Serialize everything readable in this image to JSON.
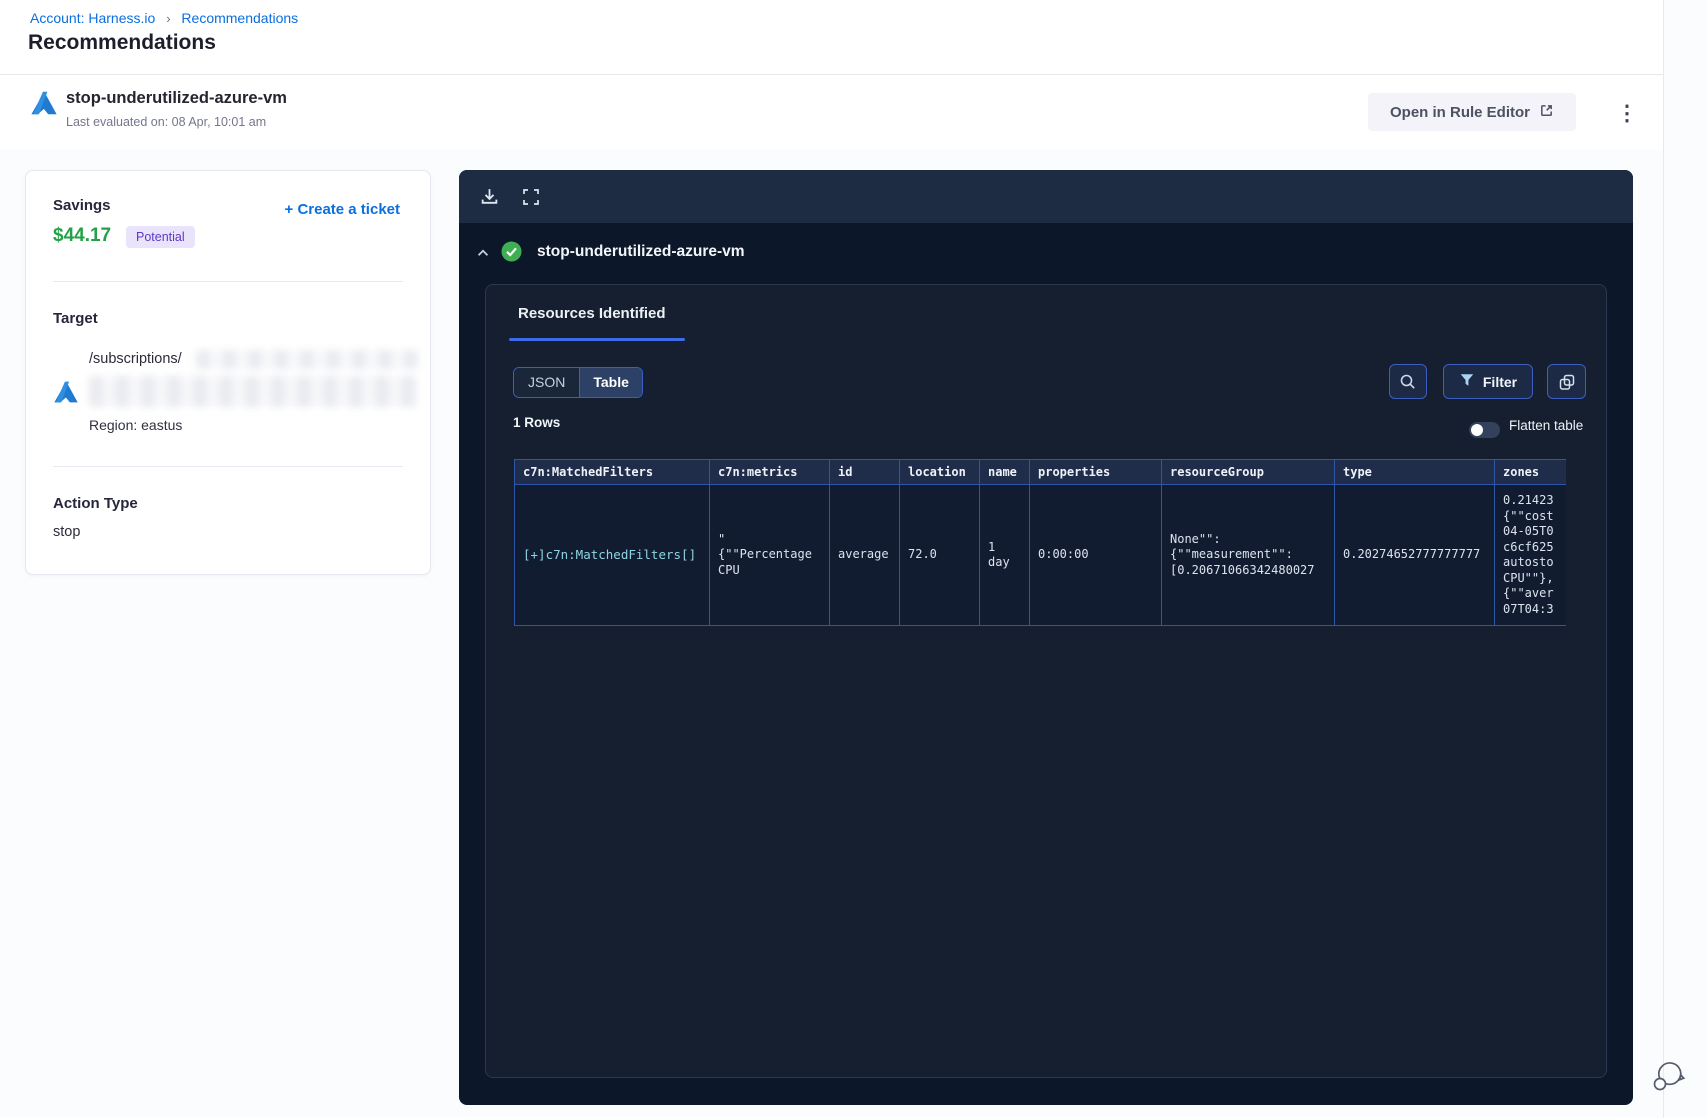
{
  "breadcrumb": {
    "account_link": "Account: Harness.io",
    "separator": "›",
    "current": "Recommendations"
  },
  "page": {
    "title": "Recommendations"
  },
  "header": {
    "name": "stop-underutilized-azure-vm",
    "last_evaluated": "Last evaluated on: 08 Apr, 10:01 am",
    "open_rule_editor": "Open in Rule Editor",
    "kebab_glyph": "⋮"
  },
  "details": {
    "savings_label": "Savings",
    "savings_amount": "$44.17",
    "savings_badge": "Potential",
    "create_ticket": "+ Create a ticket",
    "target_label": "Target",
    "target_path": "/subscriptions/",
    "region": "Region: eastus",
    "action_type_label": "Action Type",
    "action_type_value": "stop"
  },
  "viewer": {
    "rule_name": "stop-underutilized-azure-vm",
    "tab": "Resources Identified",
    "json_label": "JSON",
    "table_label": "Table",
    "filter_label": "Filter",
    "rows_count": "1 Rows",
    "flatten_label": "Flatten table"
  },
  "table": {
    "headers": [
      "c7n:MatchedFilters",
      "c7n:metrics",
      "id",
      "location",
      "name",
      "properties",
      "resourceGroup",
      "type",
      "zones"
    ],
    "row": {
      "matched_filters": "[+]c7n:MatchedFilters[]",
      "metrics": "\"\n{\"\"Percentage\nCPU",
      "id": "average",
      "location": "72.0",
      "name": "1 day",
      "properties": "0:00:00",
      "resource_group": "None\"\":\n{\"\"measurement\"\":\n[0.20671066342480027",
      "type": "0.20274652777777777",
      "zones": "0.21423\n{\"\"cost\n04-05T0\nc6cf625\nautosto\nCPU\"\"},\n{\"\"aver\n07T04:3"
    }
  },
  "colors": {
    "link_blue": "#0b6fe0",
    "savings_green": "#24a148",
    "badge_bg": "#e9e4fc",
    "badge_text": "#6038c0",
    "tab_underline": "#3d6ce8",
    "panel_bg": "#0c1729",
    "toolbar_bg": "#1e2c43",
    "inner_card_bg": "#151f30",
    "table_border": "#2d55ab",
    "check_green": "#3fae54",
    "cell_link_cyan": "#8fd4e4"
  }
}
